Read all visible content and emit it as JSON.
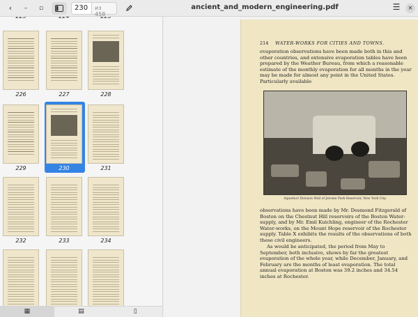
{
  "header": {
    "back_label": "‹",
    "forward_label": "‹",
    "home_label": "›",
    "sidebar_toggle_icon": "sidebar-icon",
    "page_current": "230",
    "page_of": "из 458",
    "edit_icon": "pencil-icon",
    "title": "ancient_and_modern_engineering.pdf",
    "menu_icon": "hamburger-icon",
    "close_label": "×"
  },
  "sidebar": {
    "thumbnails": [
      {
        "label": "223",
        "kind": "text"
      },
      {
        "label": "224",
        "kind": "text"
      },
      {
        "label": "225",
        "kind": "text"
      },
      {
        "label": "226",
        "kind": "table"
      },
      {
        "label": "227",
        "kind": "table"
      },
      {
        "label": "228",
        "kind": "image"
      },
      {
        "label": "229",
        "kind": "table"
      },
      {
        "label": "230",
        "kind": "image",
        "selected": true
      },
      {
        "label": "231",
        "kind": "text"
      },
      {
        "label": "232",
        "kind": "text"
      },
      {
        "label": "233",
        "kind": "text"
      },
      {
        "label": "234",
        "kind": "text"
      },
      {
        "label": "",
        "kind": "text"
      },
      {
        "label": "",
        "kind": "text"
      },
      {
        "label": "",
        "kind": "text"
      }
    ],
    "tabs": [
      {
        "name": "thumbnails-tab",
        "icon": "grid-icon",
        "glyph": "▦",
        "active": true
      },
      {
        "name": "outline-tab",
        "icon": "comment-icon",
        "glyph": "▤",
        "active": false
      },
      {
        "name": "bookmarks-tab",
        "icon": "bookmark-icon",
        "glyph": "▯",
        "active": false
      }
    ]
  },
  "document": {
    "page_number": "214",
    "running_title": "WATER-WORKS FOR CITIES AND TOWNS.",
    "paragraph_1": "evaporation observations have been made both in this and other countries, and extensive evaporation tables have been prepared by the Weather Bureau, from which a reasonable estimate of the monthly evaporation for all months in the year may be made for almost any point in the United States. Particularly available",
    "figure_caption": "Aqueduct Division Wall of Jerome Park Reservoir, New York City.",
    "paragraph_2": "observations have been made by Mr. Desmond Fitzgerald of Boston on the Chestnut Hill reservoirs of the Boston Water-supply, and by Mr. Emil Kuichling, engineer of the Rochester Water-works, on the Mount Hope reservoir of the Rochester supply. Table X exhibits the results of the observations of both these civil engineers.",
    "paragraph_3": "As would be anticipated, the period from May to September, both inclusive, shows by far the greatest evaporation of the whole year, while December, January, and February are the months of least evaporation. The total annual evaporation at Boston was 39.2 inches and 34.54 inches at Rochester."
  },
  "colors": {
    "accent": "#3584e4",
    "page_bg": "#f0e6c4"
  }
}
